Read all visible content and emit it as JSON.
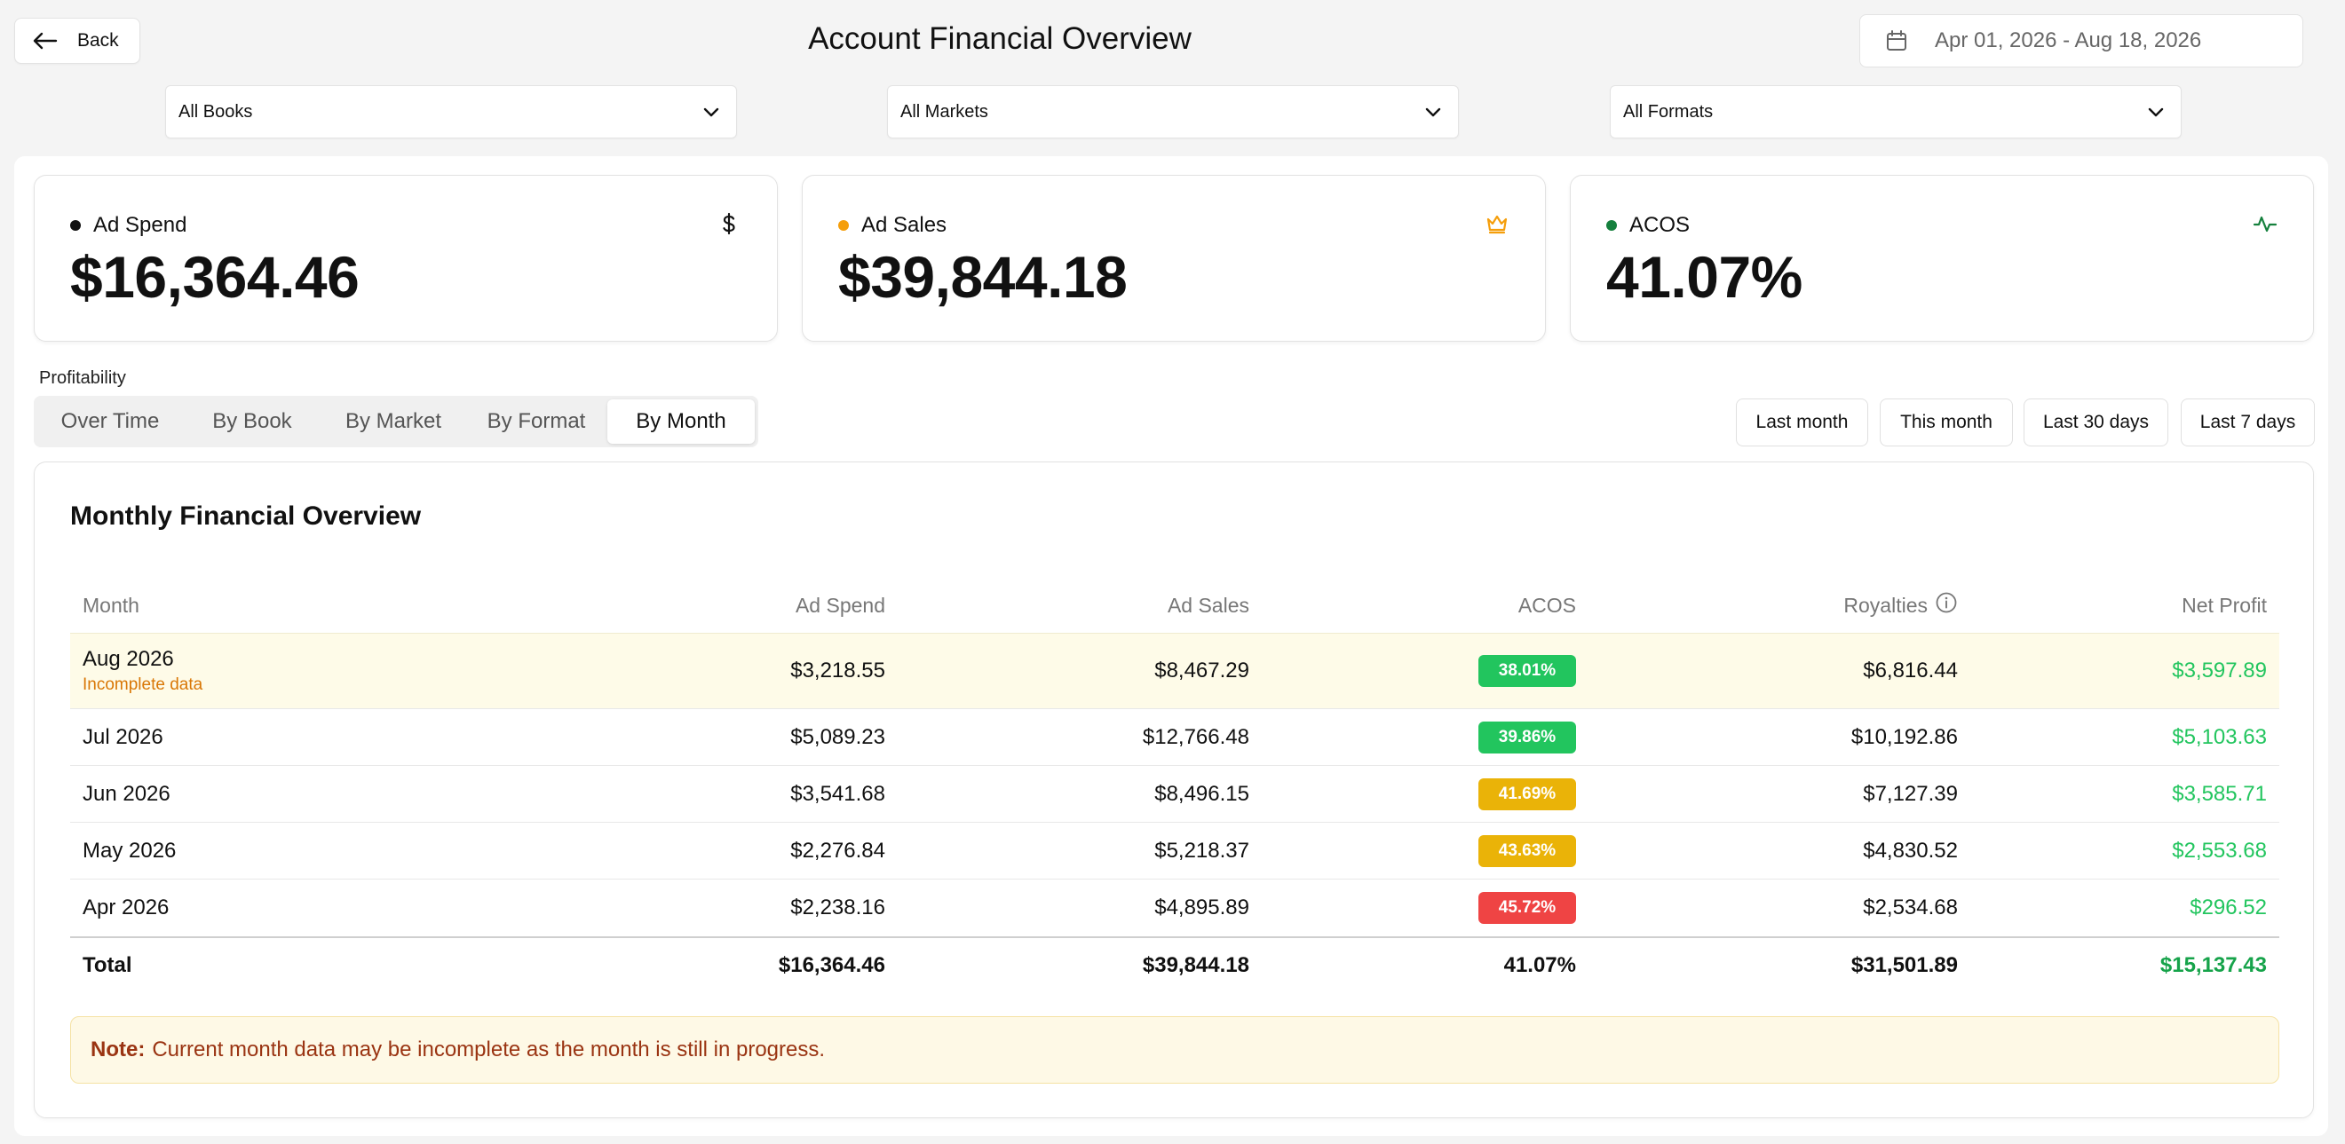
{
  "header": {
    "back_label": "Back",
    "title": "Account Financial Overview",
    "date_range": "Apr 01, 2026 - Aug 18, 2026"
  },
  "filters": {
    "books": "All Books",
    "markets": "All Markets",
    "formats": "All Formats"
  },
  "stats": [
    {
      "label": "Ad Spend",
      "value": "$16,364.46",
      "dot_color": "#111111",
      "icon": "dollar-icon"
    },
    {
      "label": "Ad Sales",
      "value": "$39,844.18",
      "dot_color": "#f59e0b",
      "icon": "crown-icon"
    },
    {
      "label": "ACOS",
      "value": "41.07%",
      "dot_color": "#15803d",
      "icon": "activity-icon"
    }
  ],
  "section_label": "Profitability",
  "tabs": [
    {
      "label": "Over Time",
      "active": false
    },
    {
      "label": "By Book",
      "active": false
    },
    {
      "label": "By Market",
      "active": false
    },
    {
      "label": "By Format",
      "active": false
    },
    {
      "label": "By Month",
      "active": true
    }
  ],
  "periods": [
    "Last month",
    "This month",
    "Last 30 days",
    "Last 7 days"
  ],
  "table": {
    "title": "Monthly Financial Overview",
    "headers": {
      "month": "Month",
      "ad_spend": "Ad Spend",
      "ad_sales": "Ad Sales",
      "acos": "ACOS",
      "royalties": "Royalties",
      "net_profit": "Net Profit"
    },
    "rows": [
      {
        "month": "Aug 2026",
        "note": "Incomplete data",
        "ad_spend": "$3,218.55",
        "ad_sales": "$8,467.29",
        "acos": "38.01%",
        "acos_color": "#22c55e",
        "royalties": "$6,816.44",
        "net_profit": "$3,597.89"
      },
      {
        "month": "Jul 2026",
        "ad_spend": "$5,089.23",
        "ad_sales": "$12,766.48",
        "acos": "39.86%",
        "acos_color": "#22c55e",
        "royalties": "$10,192.86",
        "net_profit": "$5,103.63"
      },
      {
        "month": "Jun 2026",
        "ad_spend": "$3,541.68",
        "ad_sales": "$8,496.15",
        "acos": "41.69%",
        "acos_color": "#eab308",
        "royalties": "$7,127.39",
        "net_profit": "$3,585.71"
      },
      {
        "month": "May 2026",
        "ad_spend": "$2,276.84",
        "ad_sales": "$5,218.37",
        "acos": "43.63%",
        "acos_color": "#eab308",
        "royalties": "$4,830.52",
        "net_profit": "$2,553.68"
      },
      {
        "month": "Apr 2026",
        "ad_spend": "$2,238.16",
        "ad_sales": "$4,895.89",
        "acos": "45.72%",
        "acos_color": "#ef4444",
        "royalties": "$2,534.68",
        "net_profit": "$296.52"
      }
    ],
    "total": {
      "label": "Total",
      "ad_spend": "$16,364.46",
      "ad_sales": "$39,844.18",
      "acos": "41.07%",
      "royalties": "$31,501.89",
      "net_profit": "$15,137.43"
    },
    "note_label": "Note:",
    "note_text": "Current month data may be incomplete as the month is still in progress."
  }
}
